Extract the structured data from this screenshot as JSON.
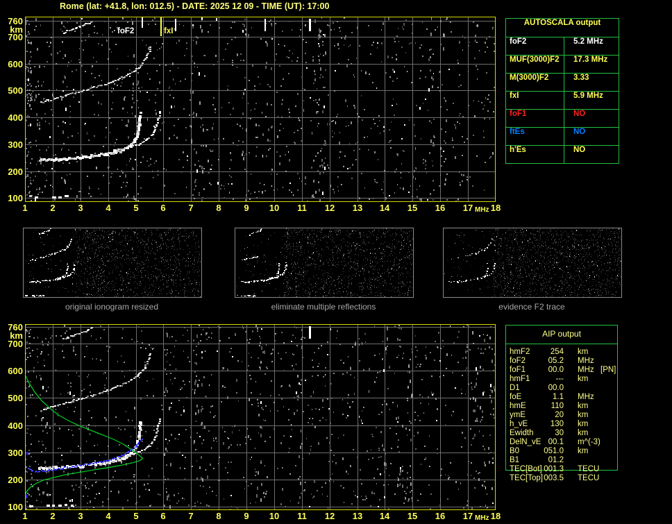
{
  "title": "Rome (lat: +41.8, lon: 012.5) - DATE: 2025 12 09 - TIME (UT): 17:00",
  "colors": {
    "accent_yellow": "#ffff55",
    "pale_yellow": "#ffff8c",
    "title_yellow": "#ffff7d",
    "frame_yellow": "#d8d800",
    "grid_gray": "#6e6e6e",
    "table_green": "#22c240",
    "value_white": "#ffffff",
    "alert_red": "#ff2222",
    "info_blue": "#0080ff",
    "caption_gray": "#a8a8a8",
    "trace_white": "#ffffff",
    "profile_green": "#00c825",
    "restored_blue": "#2a2ae8"
  },
  "axes": {
    "x_ticks": [
      "1",
      "2",
      "3",
      "4",
      "5",
      "6",
      "7",
      "8",
      "9",
      "10",
      "11",
      "12",
      "13",
      "14",
      "15",
      "16",
      "17",
      "18"
    ],
    "x_unit": "MHz",
    "y_ticks": [
      "760",
      "700",
      "600",
      "500",
      "400",
      "300",
      "200",
      "100"
    ],
    "y_unit": "km"
  },
  "top_ionogram": {
    "foF2_label": "foF2",
    "fxI_label": "fxI"
  },
  "thumbnails": [
    {
      "caption": "original ionogram resized"
    },
    {
      "caption": "eliminate multiple reflections"
    },
    {
      "caption": "evidence F2 trace"
    }
  ],
  "autoscala_table": {
    "title": "AUTOSCALA output",
    "rows": [
      {
        "label": "foF2",
        "value": "5.2 MHz",
        "color": "#ffffff"
      },
      {
        "label": "MUF(3000)F2",
        "value": "17.3 MHz",
        "color": "#ffff55"
      },
      {
        "label": "M(3000)F2",
        "value": "3.33",
        "color": "#ffff55"
      },
      {
        "label": "fxI",
        "value": "5.9 MHz",
        "color": "#ffff55"
      },
      {
        "label": "foF1",
        "value": "NO",
        "color": "#ff2222"
      },
      {
        "label": "ftEs",
        "value": "NO",
        "color": "#0080ff"
      },
      {
        "label": "h'Es",
        "value": "NO",
        "color": "#ffff55"
      }
    ]
  },
  "aip_table": {
    "title": "AIP output",
    "rows": [
      {
        "label": "hmF2",
        "value": "254",
        "unit": "km",
        "flag": ""
      },
      {
        "label": "foF2",
        "value": "05.2",
        "unit": "MHz",
        "flag": ""
      },
      {
        "label": "foF1",
        "value": "00.0",
        "unit": "MHz",
        "flag": "[PN]"
      },
      {
        "label": "hmF1",
        "value": "---",
        "unit": "km",
        "flag": ""
      },
      {
        "label": "D1",
        "value": "00.0",
        "unit": "",
        "flag": ""
      },
      {
        "label": "foE",
        "value": "1.1",
        "unit": "MHz",
        "flag": ""
      },
      {
        "label": "hmE",
        "value": "110",
        "unit": "km",
        "flag": ""
      },
      {
        "label": "ymE",
        "value": "20",
        "unit": "km",
        "flag": ""
      },
      {
        "label": "h_vE",
        "value": "130",
        "unit": "km",
        "flag": ""
      },
      {
        "label": "Ewidth",
        "value": "30",
        "unit": "km",
        "flag": ""
      },
      {
        "label": "DelN_vE",
        "value": "00.1",
        "unit": "m^(-3)",
        "flag": ""
      },
      {
        "label": "B0",
        "value": "051.0",
        "unit": "km",
        "flag": ""
      },
      {
        "label": "B1",
        "value": "01.2",
        "unit": "",
        "flag": ""
      },
      {
        "label": "TEC[Bot]",
        "value": "001.3",
        "unit": "TECU",
        "flag": ""
      },
      {
        "label": "TEC[Top]",
        "value": "003.5",
        "unit": "TECU",
        "flag": ""
      }
    ]
  },
  "chart_data": [
    {
      "type": "scatter",
      "title": "ionogram with AUTOSCALA markers",
      "xlabel": "MHz",
      "ylabel": "km",
      "xlim": [
        1,
        18
      ],
      "ylim": [
        85,
        775
      ],
      "grid": true,
      "markers": {
        "foF2_mhz": 5.2,
        "fxI_mhz": 5.9
      },
      "interference_lines_mhz": [
        6.42,
        9.65,
        11.25
      ],
      "series": [
        {
          "name": "F2_trace_ordinary",
          "color": "white",
          "points": [
            [
              1.5,
              243
            ],
            [
              1.9,
              244
            ],
            [
              2.3,
              246
            ],
            [
              2.7,
              249
            ],
            [
              3.1,
              253
            ],
            [
              3.5,
              258
            ],
            [
              3.9,
              264
            ],
            [
              4.2,
              271
            ],
            [
              4.5,
              280
            ],
            [
              4.75,
              292
            ],
            [
              4.9,
              307
            ],
            [
              5.0,
              325
            ],
            [
              5.08,
              350
            ],
            [
              5.13,
              378
            ],
            [
              5.16,
              420
            ]
          ]
        },
        {
          "name": "F2_trace_extraordinary",
          "color": "white",
          "points": [
            [
              4.2,
              276
            ],
            [
              4.5,
              283
            ],
            [
              4.8,
              291
            ],
            [
              5.1,
              300
            ],
            [
              5.3,
              310
            ],
            [
              5.5,
              325
            ],
            [
              5.65,
              343
            ],
            [
              5.75,
              368
            ],
            [
              5.82,
              400
            ],
            [
              5.86,
              430
            ]
          ]
        },
        {
          "name": "second_hop",
          "color": "white",
          "points": [
            [
              1.6,
              455
            ],
            [
              2.0,
              468
            ],
            [
              2.5,
              482
            ],
            [
              3.0,
              496
            ],
            [
              3.5,
              511
            ],
            [
              4.0,
              527
            ],
            [
              4.4,
              544
            ],
            [
              4.8,
              563
            ],
            [
              5.1,
              585
            ],
            [
              5.3,
              610
            ],
            [
              5.45,
              640
            ],
            [
              5.55,
              668
            ]
          ]
        },
        {
          "name": "third_hop",
          "color": "white",
          "points": [
            [
              2.4,
              716
            ],
            [
              2.7,
              727
            ],
            [
              3.0,
              739
            ],
            [
              3.3,
              752
            ],
            [
              3.5,
              762
            ]
          ]
        },
        {
          "name": "E_layer",
          "color": "white",
          "points": [
            [
              1.15,
              105
            ],
            [
              2.2,
              104
            ],
            [
              2.9,
              104
            ]
          ]
        }
      ]
    },
    {
      "type": "scatter",
      "title": "ionogram with restored trace and electron density profile",
      "xlabel": "MHz",
      "ylabel": "km",
      "xlim": [
        1,
        18
      ],
      "ylim": [
        85,
        775
      ],
      "grid": true,
      "interference_lines_mhz": [
        11.25
      ],
      "series": [
        {
          "name": "F2_trace_ordinary",
          "color": "white",
          "points": [
            [
              1.5,
              243
            ],
            [
              1.9,
              244
            ],
            [
              2.3,
              246
            ],
            [
              2.7,
              249
            ],
            [
              3.1,
              253
            ],
            [
              3.5,
              258
            ],
            [
              3.9,
              264
            ],
            [
              4.2,
              271
            ],
            [
              4.5,
              280
            ],
            [
              4.75,
              292
            ],
            [
              4.9,
              307
            ],
            [
              5.0,
              325
            ],
            [
              5.08,
              350
            ],
            [
              5.13,
              378
            ],
            [
              5.16,
              420
            ]
          ]
        },
        {
          "name": "F2_trace_extraordinary",
          "color": "white",
          "points": [
            [
              4.2,
              276
            ],
            [
              4.5,
              283
            ],
            [
              4.8,
              291
            ],
            [
              5.1,
              300
            ],
            [
              5.3,
              310
            ],
            [
              5.5,
              325
            ],
            [
              5.65,
              343
            ],
            [
              5.75,
              368
            ],
            [
              5.82,
              400
            ],
            [
              5.86,
              430
            ]
          ]
        },
        {
          "name": "second_hop",
          "color": "white",
          "points": [
            [
              1.6,
              455
            ],
            [
              2.0,
              468
            ],
            [
              2.5,
              482
            ],
            [
              3.0,
              496
            ],
            [
              3.5,
              511
            ],
            [
              4.0,
              527
            ],
            [
              4.4,
              544
            ],
            [
              4.8,
              563
            ],
            [
              5.1,
              585
            ],
            [
              5.3,
              610
            ],
            [
              5.45,
              640
            ],
            [
              5.55,
              668
            ]
          ]
        },
        {
          "name": "third_hop",
          "color": "white",
          "points": [
            [
              2.4,
              716
            ],
            [
              2.7,
              727
            ],
            [
              3.0,
              739
            ],
            [
              3.3,
              752
            ],
            [
              3.5,
              762
            ]
          ]
        },
        {
          "name": "E_layer",
          "color": "white",
          "points": [
            [
              1.15,
              105
            ],
            [
              2.2,
              104
            ],
            [
              2.9,
              104
            ]
          ]
        },
        {
          "name": "density_profile",
          "color": "green",
          "points": [
            [
              1.0,
              585
            ],
            [
              1.15,
              555
            ],
            [
              1.35,
              522
            ],
            [
              1.6,
              490
            ],
            [
              1.9,
              462
            ],
            [
              2.2,
              438
            ],
            [
              2.6,
              415
            ],
            [
              3.0,
              396
            ],
            [
              3.4,
              380
            ],
            [
              3.8,
              364
            ],
            [
              4.2,
              348
            ],
            [
              4.55,
              330
            ],
            [
              4.85,
              310
            ],
            [
              5.05,
              295
            ],
            [
              5.18,
              285
            ],
            [
              5.25,
              278
            ],
            [
              5.15,
              270
            ],
            [
              4.9,
              262
            ],
            [
              4.5,
              253
            ],
            [
              4.0,
              244
            ],
            [
              3.5,
              236
            ],
            [
              3.0,
              227
            ],
            [
              2.5,
              219
            ],
            [
              2.0,
              207
            ],
            [
              1.66,
              198
            ],
            [
              1.4,
              186
            ],
            [
              1.2,
              172
            ],
            [
              1.07,
              158
            ],
            [
              1.0,
              142
            ],
            [
              0.98,
              120
            ],
            [
              0.97,
              105
            ]
          ]
        },
        {
          "name": "restored_trace",
          "color": "blue",
          "points": [
            [
              1.12,
              240
            ],
            [
              1.25,
              232
            ],
            [
              1.45,
              230
            ],
            [
              1.7,
              232
            ],
            [
              2.0,
              236
            ],
            [
              2.3,
              240
            ],
            [
              2.6,
              245
            ],
            [
              2.9,
              250
            ],
            [
              3.2,
              255
            ],
            [
              3.5,
              260
            ],
            [
              3.8,
              266
            ],
            [
              4.1,
              273
            ],
            [
              4.35,
              281
            ],
            [
              4.6,
              292
            ],
            [
              4.8,
              305
            ],
            [
              4.95,
              318
            ],
            [
              5.08,
              331
            ],
            [
              5.17,
              342
            ],
            [
              5.24,
              352
            ]
          ]
        },
        {
          "name": "profile_edge_markers",
          "color": "blue",
          "points": [
            [
              1.07,
              296
            ],
            [
              1.04,
              139
            ]
          ]
        }
      ]
    }
  ]
}
